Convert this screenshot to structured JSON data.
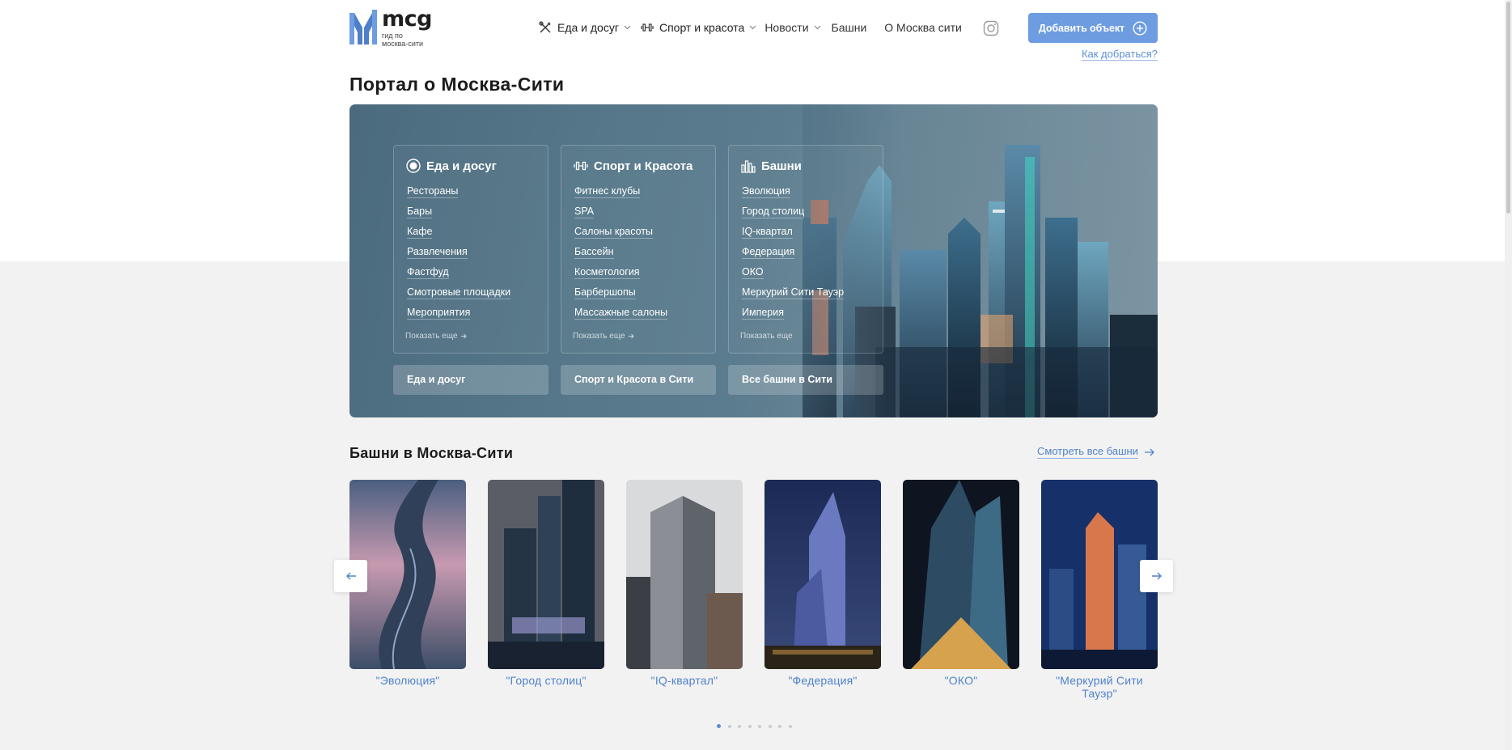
{
  "logo": {
    "word": "mcg",
    "sub_line1": "гид по",
    "sub_line2": "москва-сити"
  },
  "nav": {
    "items": [
      {
        "label": "Еда и досуг",
        "icon": "cutlery-icon",
        "dropdown": true
      },
      {
        "label": "Спорт и красота",
        "icon": "dumbbell-icon",
        "dropdown": true
      },
      {
        "label": "Новости",
        "dropdown": true
      },
      {
        "label": "Башни",
        "dropdown": false
      },
      {
        "label": "О Москва сити",
        "dropdown": false
      }
    ],
    "social_icon": "instagram-icon"
  },
  "header": {
    "add_button": "Добавить объект",
    "how_link": "Как добраться?"
  },
  "page_title": "Портал о Москва-Сити",
  "hero": {
    "cards": [
      {
        "title": "Еда и досуг",
        "icon": "plate-icon",
        "items": [
          "Рестораны",
          "Бары",
          "Кафе",
          "Развлечения",
          "Фастфуд",
          "Смотровые площадки",
          "Мероприятия"
        ],
        "more": "Показать еще",
        "button": "Еда и досуг"
      },
      {
        "title": "Спорт и Красота",
        "icon": "dumbbell-icon",
        "items": [
          "Фитнес клубы",
          "SPA",
          "Салоны красоты",
          "Бассейн",
          "Косметология",
          "Барбершопы",
          "Массажные салоны"
        ],
        "more": "Показать еще",
        "button": "Спорт и Красота в Сити"
      },
      {
        "title": "Башни",
        "icon": "buildings-icon",
        "items": [
          "Эволюция",
          "Город столиц",
          "IQ-квартал",
          "Федерация",
          "ОКО",
          "Меркурий Сити Тауэр",
          "Империя"
        ],
        "more": "Показать еще",
        "button": "Все башни в Сити"
      }
    ]
  },
  "towers_section": {
    "title": "Башни в Москва-Сити",
    "see_all": "Смотреть все башни",
    "towers": [
      {
        "name": "\"Эволюция\""
      },
      {
        "name": "\"Город столиц\""
      },
      {
        "name": "\"IQ-квартал\""
      },
      {
        "name": "\"Федерация\""
      },
      {
        "name": "\"ОКО\""
      },
      {
        "name": "\"Меркурий Сити Тауэр\""
      }
    ],
    "pagination_count": 8,
    "pagination_active": 1
  },
  "colors": {
    "accent": "#6d9ce0",
    "link": "#4f82cc",
    "hero_bg": "#587a8c"
  }
}
